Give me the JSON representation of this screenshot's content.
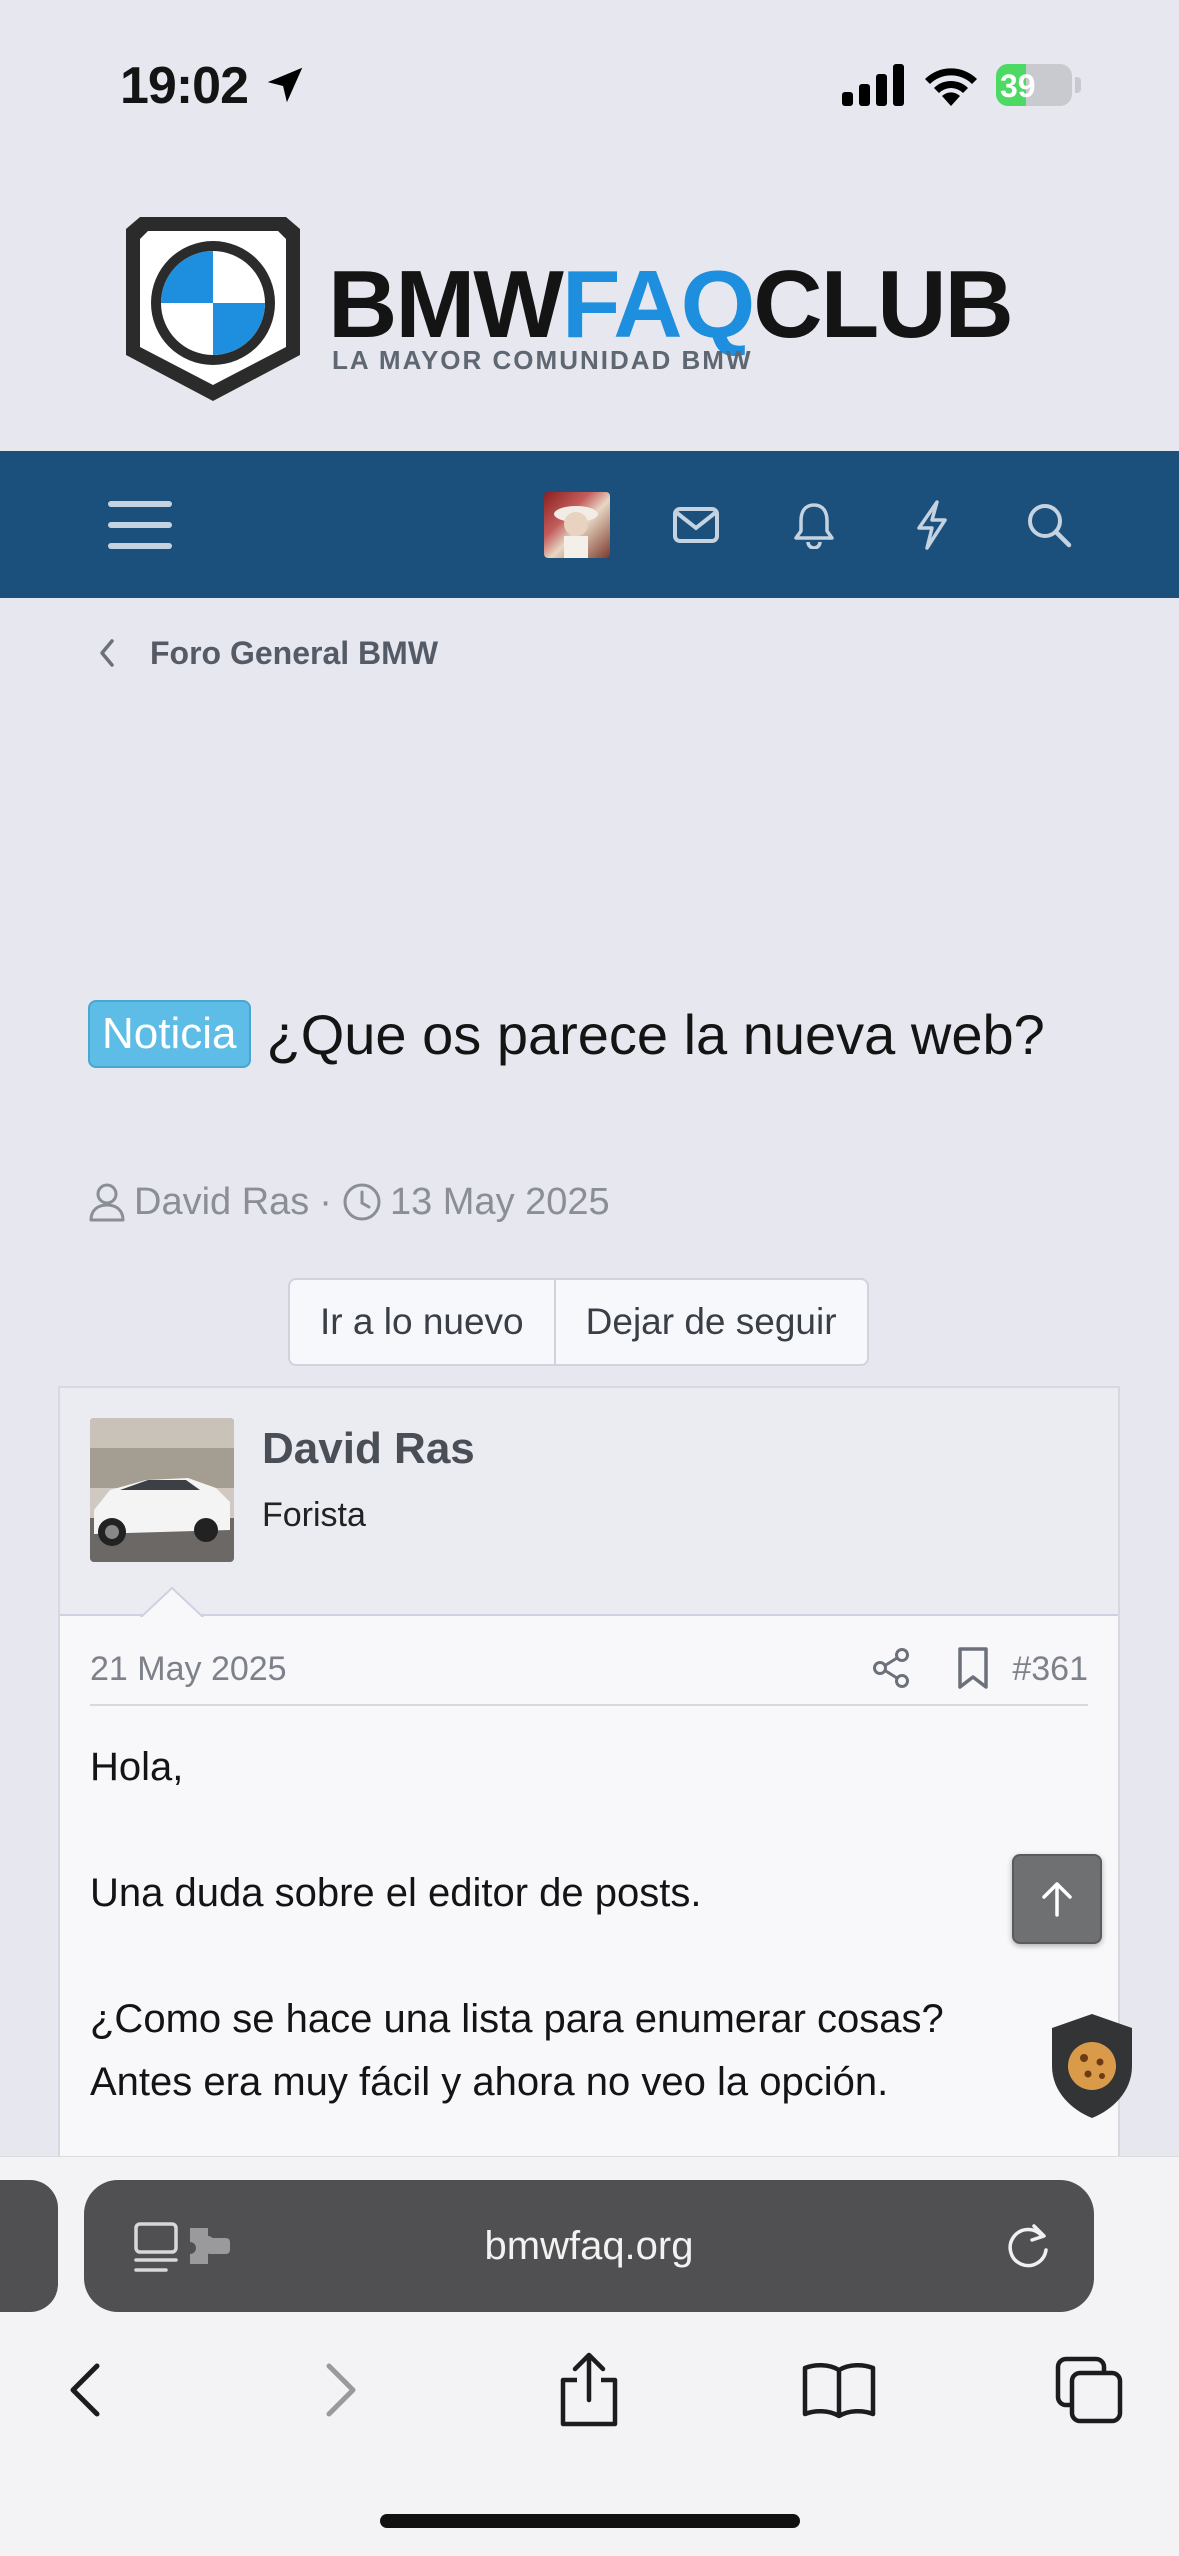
{
  "status_bar": {
    "time": "19:02",
    "battery_level": "39",
    "battery_fraction": 0.39
  },
  "header": {
    "logo_part1": "BMW",
    "logo_part2": "FAQ",
    "logo_part3": "CLUB",
    "tagline": "LA MAYOR COMUNIDAD BMW",
    "accent_color": "#1e8fde",
    "nav_color": "#1b4f7c"
  },
  "nav": {
    "icons": [
      "hamburger-menu-icon",
      "user-avatar",
      "mail-icon",
      "bell-icon",
      "bolt-icon",
      "search-icon"
    ]
  },
  "breadcrumb": {
    "label": "Foro General BMW"
  },
  "thread": {
    "prefix": "Noticia",
    "title": "¿Que os parece la nueva web?",
    "author": "David Ras",
    "separator": "·",
    "date": "13 May 2025"
  },
  "actions": {
    "go_new": "Ir a lo nuevo",
    "unfollow": "Dejar de seguir"
  },
  "post": {
    "username": "David Ras",
    "user_title": "Forista",
    "date": "21 May 2025",
    "number": "#361",
    "body": [
      "Hola,",
      "",
      "Una duda sobre el editor de posts.",
      "",
      "¿Como se hace una lista para enumerar cosas?",
      "Antes era muy fácil y ahora no veo la opción."
    ]
  },
  "browser": {
    "url": "bmwfaq.org"
  }
}
